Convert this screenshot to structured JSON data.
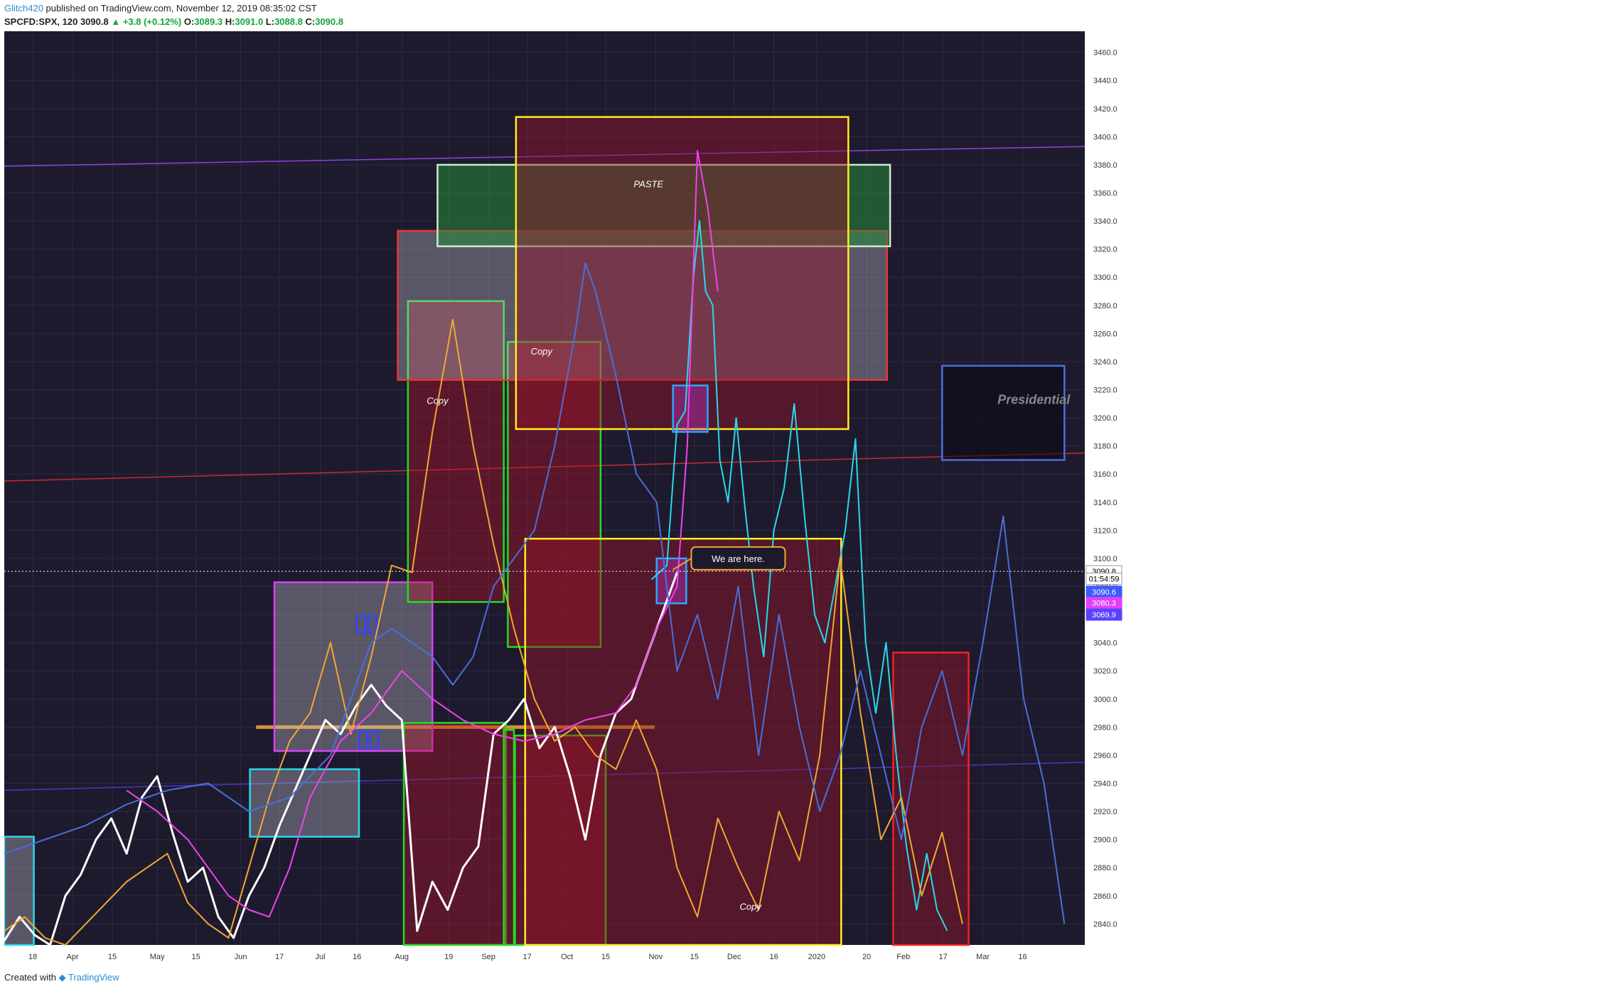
{
  "header": {
    "author": "Glitch420",
    "published_text": "published on TradingView.com, November 12, 2019 08:35:02 CST",
    "symbol": "SPCFD:SPX, 120",
    "last": "3090.8",
    "change": "+3.8 (+0.12%)",
    "o_label": "O:",
    "o_value": "3089.3",
    "h_label": "H:",
    "h_value": "3091.0",
    "l_label": "L:",
    "l_value": "3088.8",
    "c_label": "C:",
    "c_value": "3090.8"
  },
  "footer": {
    "created_with": "Created with",
    "brand": "TradingView"
  },
  "chart_data": {
    "type": "line",
    "ylim": [
      2825,
      3475
    ],
    "xlim": [
      0,
      106
    ],
    "grid": true,
    "y_ticks": [
      2840,
      2860,
      2880,
      2900,
      2920,
      2940,
      2960,
      2980,
      3000,
      3020,
      3040,
      3060,
      3080,
      3100,
      3120,
      3140,
      3160,
      3180,
      3200,
      3220,
      3240,
      3260,
      3280,
      3300,
      3320,
      3340,
      3360,
      3380,
      3400,
      3420,
      3440,
      3460
    ],
    "x_ticks": [
      {
        "x": 2.8,
        "label": "18"
      },
      {
        "x": 6.7,
        "label": "Apr"
      },
      {
        "x": 10.6,
        "label": "15"
      },
      {
        "x": 15,
        "label": "May"
      },
      {
        "x": 18.8,
        "label": "15"
      },
      {
        "x": 23.2,
        "label": "Jun"
      },
      {
        "x": 27,
        "label": "17"
      },
      {
        "x": 31,
        "label": "Jul"
      },
      {
        "x": 34.6,
        "label": "16"
      },
      {
        "x": 39,
        "label": "Aug"
      },
      {
        "x": 43.6,
        "label": "19"
      },
      {
        "x": 47.5,
        "label": "Sep"
      },
      {
        "x": 51.3,
        "label": "17"
      },
      {
        "x": 55.2,
        "label": "Oct"
      },
      {
        "x": 59,
        "label": "15"
      },
      {
        "x": 63.9,
        "label": "Nov"
      },
      {
        "x": 67.7,
        "label": "15"
      },
      {
        "x": 71.6,
        "label": "Dec"
      },
      {
        "x": 75.5,
        "label": "16"
      },
      {
        "x": 79.7,
        "label": "2020"
      },
      {
        "x": 84.6,
        "label": "20"
      },
      {
        "x": 88.2,
        "label": "Feb"
      },
      {
        "x": 92.1,
        "label": "17"
      },
      {
        "x": 96,
        "label": "Mar"
      },
      {
        "x": 99.9,
        "label": "16"
      }
    ],
    "price_labels": [
      {
        "value": 3090.8,
        "label": "3090.8",
        "color": "#ffffff",
        "text": "#000000"
      },
      {
        "value": 3085.5,
        "label": "01:54:59",
        "color": "#ffffff",
        "text": "#000000"
      },
      {
        "value": 3076.3,
        "label": "3090.6",
        "color": "#3d5afe",
        "text": "#ffffff"
      },
      {
        "value": 3068.3,
        "label": "3080.3",
        "color": "#e040fb",
        "text": "#ffffff"
      },
      {
        "value": 3060.0,
        "label": "3069.9",
        "color": "#5c40ff",
        "text": "#ffffff"
      }
    ],
    "current_price": 3090.8,
    "series": [
      {
        "color": "#ffffff",
        "x": [
          0,
          1.5,
          3,
          4.5,
          6,
          7.5,
          9,
          10.5,
          12,
          13.5,
          15,
          16.5,
          18,
          19.5,
          21,
          22.5,
          24,
          25.5,
          27,
          28.5,
          30,
          31.5,
          33,
          34.5,
          36,
          37.5,
          39,
          40.5,
          42,
          43.5,
          45,
          46.5,
          48,
          49.5,
          51,
          52.5,
          54,
          55.5,
          57,
          58.5,
          60,
          61.5,
          63,
          64.5,
          66
        ],
        "y": [
          2828,
          2845,
          2832,
          2825,
          2860,
          2875,
          2900,
          2915,
          2890,
          2930,
          2945,
          2905,
          2870,
          2880,
          2845,
          2830,
          2860,
          2880,
          2910,
          2935,
          2960,
          2985,
          2975,
          2995,
          3010,
          2995,
          2985,
          2835,
          2870,
          2850,
          2880,
          2895,
          2975,
          2985,
          3000,
          2965,
          2980,
          2945,
          2900,
          2960,
          2990,
          3000,
          3030,
          3060,
          3090
        ]
      },
      {
        "color": "#29d9e8",
        "x": [
          63.5,
          65,
          66,
          66.8,
          67.6,
          68.2,
          68.8,
          69.5,
          70.2,
          71,
          71.8,
          72.6,
          73.5,
          74.5,
          75.5,
          76.5,
          77.5,
          78.5,
          79.5,
          80.5,
          81.5,
          82.5,
          83.5,
          84.5,
          85.5,
          86.5,
          87.5,
          88.5,
          89.5,
          90.5,
          91.5,
          92.5
        ],
        "y": [
          3085,
          3095,
          3195,
          3205,
          3300,
          3340,
          3290,
          3280,
          3170,
          3140,
          3200,
          3140,
          3080,
          3030,
          3120,
          3150,
          3210,
          3130,
          3060,
          3040,
          3080,
          3120,
          3185,
          3040,
          2990,
          3040,
          2960,
          2895,
          2850,
          2890,
          2850,
          2835
        ]
      },
      {
        "color": "#f0a832",
        "x": [
          0,
          2,
          4,
          6,
          8,
          10,
          12,
          14,
          16,
          18,
          20,
          22,
          24,
          26,
          28,
          30,
          32,
          34,
          36,
          38,
          40,
          42,
          44,
          46,
          48,
          50,
          52,
          54,
          56,
          58,
          60,
          62,
          64,
          66,
          68,
          70,
          72,
          74,
          76,
          78,
          80,
          82,
          84,
          86,
          88,
          90,
          92,
          94
        ],
        "y": [
          2835,
          2845,
          2830,
          2825,
          2840,
          2855,
          2870,
          2880,
          2890,
          2855,
          2840,
          2830,
          2880,
          2930,
          2970,
          2990,
          3040,
          2975,
          3030,
          3095,
          3090,
          3190,
          3270,
          3180,
          3110,
          3050,
          3000,
          2970,
          2980,
          2960,
          2950,
          2985,
          2950,
          2880,
          2845,
          2915,
          2880,
          2850,
          2920,
          2885,
          2960,
          3100,
          2990,
          2900,
          2930,
          2860,
          2905,
          2840
        ]
      },
      {
        "color": "#ee44ee",
        "x": [
          12,
          15,
          18,
          20,
          22,
          24,
          26,
          28,
          30,
          33,
          36,
          39,
          42,
          45,
          48,
          51,
          54,
          57,
          60,
          62,
          64,
          66,
          67,
          68,
          69,
          70
        ],
        "y": [
          2935,
          2920,
          2900,
          2880,
          2860,
          2850,
          2845,
          2880,
          2930,
          2970,
          2990,
          3020,
          3000,
          2985,
          2975,
          2970,
          2975,
          2985,
          2990,
          3010,
          3050,
          3080,
          3180,
          3390,
          3350,
          3290
        ]
      },
      {
        "color": "#4a6fd8",
        "x": [
          0,
          4,
          8,
          12,
          16,
          20,
          24,
          28,
          32,
          36,
          38,
          40,
          42,
          44,
          46,
          48,
          50,
          52,
          54,
          56,
          57,
          58,
          60,
          62,
          64,
          66,
          68,
          70,
          72,
          74,
          76,
          78,
          80,
          82,
          84,
          86,
          88,
          90,
          92,
          94,
          96,
          98,
          100,
          102,
          104
        ],
        "y": [
          2890,
          2900,
          2910,
          2925,
          2935,
          2940,
          2920,
          2930,
          2960,
          3040,
          3050,
          3040,
          3030,
          3010,
          3030,
          3080,
          3100,
          3120,
          3180,
          3260,
          3310,
          3290,
          3230,
          3160,
          3140,
          3020,
          3060,
          3000,
          3080,
          2960,
          3060,
          2980,
          2920,
          2960,
          3020,
          2960,
          2900,
          2980,
          3020,
          2960,
          3040,
          3130,
          3000,
          2940,
          2840
        ]
      }
    ],
    "boxes": [
      {
        "x0": 0,
        "x1": 2.9,
        "y0": 2825,
        "y1": 2902,
        "fill": "rgba(200,200,210,0.35)",
        "stroke": "#29d9e8"
      },
      {
        "x0": 24.1,
        "x1": 34.8,
        "y0": 2902,
        "y1": 2950,
        "fill": "rgba(200,200,210,0.35)",
        "stroke": "#29d9e8"
      },
      {
        "x0": 26.5,
        "x1": 42,
        "y0": 2963,
        "y1": 3083,
        "fill": "rgba(200,200,210,0.35)",
        "stroke": "#e040fb"
      },
      {
        "x0": 39.2,
        "x1": 49.2,
        "y0": 2825,
        "y1": 2983,
        "fill": "rgba(180,20,40,0.40)",
        "stroke": "#22dd22"
      },
      {
        "x0": 39.6,
        "x1": 49,
        "y0": 3069,
        "y1": 3283,
        "fill": "rgba(180,20,40,0.40)",
        "stroke": "#22dd22"
      },
      {
        "x0": 49.4,
        "x1": 58.5,
        "y0": 3037,
        "y1": 3254,
        "fill": "rgba(180,20,40,0.40)",
        "stroke": "#22dd22"
      },
      {
        "x0": 49,
        "x1": 50,
        "y0": 2825,
        "y1": 2978,
        "fill": "rgba(180,20,40,0.40)",
        "stroke": "#22dd22"
      },
      {
        "x0": 50.1,
        "x1": 59,
        "y0": 2825,
        "y1": 2974,
        "fill": "rgba(180,20,40,0.40)",
        "stroke": "#22dd22"
      },
      {
        "x0": 38.6,
        "x1": 86.6,
        "y0": 3227,
        "y1": 3333,
        "fill": "rgba(200,200,210,0.35)",
        "stroke": "#ee3333"
      },
      {
        "x0": 42.5,
        "x1": 86.9,
        "y0": 3322,
        "y1": 3380,
        "fill": "rgba(40,140,60,0.55)",
        "stroke": "#cfeacf"
      },
      {
        "x0": 50.2,
        "x1": 82.8,
        "y0": 3192,
        "y1": 3414,
        "fill": "rgba(150,20,40,0.45)",
        "stroke": "#ffee22"
      },
      {
        "x0": 51.1,
        "x1": 82.1,
        "y0": 2825,
        "y1": 3114,
        "fill": "rgba(150,20,40,0.45)",
        "stroke": "#ffee22"
      },
      {
        "x0": 87.2,
        "x1": 94.6,
        "y0": 2825,
        "y1": 3033,
        "fill": "rgba(150,20,40,0.45)",
        "stroke": "#ee2222"
      },
      {
        "x0": 92,
        "x1": 104,
        "y0": 3170,
        "y1": 3237,
        "fill": "rgba(10,10,20,0.60)",
        "stroke": "#4a6fd8"
      },
      {
        "x0": 65.6,
        "x1": 69,
        "y0": 3190,
        "y1": 3223,
        "fill": "rgba(224,64,251,0.30)",
        "stroke": "#29a8ff"
      },
      {
        "x0": 64,
        "x1": 66.9,
        "y0": 3068,
        "y1": 3100,
        "fill": "rgba(224,64,251,0.30)",
        "stroke": "#29a8ff"
      },
      {
        "x0": 34.6,
        "x1": 35.4,
        "y0": 3047,
        "y1": 3059,
        "fill": "rgba(0,0,0,0)",
        "stroke": "#3344ff"
      },
      {
        "x0": 35.7,
        "x1": 36.5,
        "y0": 3047,
        "y1": 3059,
        "fill": "rgba(0,0,0,0)",
        "stroke": "#3344ff"
      },
      {
        "x0": 34.8,
        "x1": 35.6,
        "y0": 2965,
        "y1": 2977,
        "fill": "rgba(0,0,0,0)",
        "stroke": "#3344ff"
      },
      {
        "x0": 35.9,
        "x1": 36.7,
        "y0": 2965,
        "y1": 2977,
        "fill": "rgba(0,0,0,0)",
        "stroke": "#3344ff"
      }
    ],
    "lines": [
      {
        "x0": 0,
        "y0": 3379,
        "x1": 106,
        "y1": 3393,
        "color": "#9c4dff"
      },
      {
        "x0": 0,
        "y0": 3155,
        "x1": 106,
        "y1": 3175,
        "color": "#e33030"
      },
      {
        "x0": 0,
        "y0": 2935,
        "x1": 106,
        "y1": 2955,
        "color": "#4a3fd8"
      },
      {
        "x0": 24.7,
        "y0": 2980,
        "x1": 63.8,
        "y1": 2980,
        "color": "#f0a832",
        "width": 5
      }
    ],
    "annotations": [
      {
        "x": 42.5,
        "y": 3210,
        "text": "Copy"
      },
      {
        "x": 52.7,
        "y": 3245,
        "text": "Copy"
      },
      {
        "x": 63.2,
        "y": 3364,
        "text": "PASTE"
      },
      {
        "x": 73.2,
        "y": 2850,
        "text": "Copy"
      },
      {
        "x": 101,
        "y": 3210,
        "text": "Presidential",
        "big": true
      }
    ],
    "callout": {
      "x": 72,
      "y": 3100,
      "text": "We are here."
    }
  }
}
